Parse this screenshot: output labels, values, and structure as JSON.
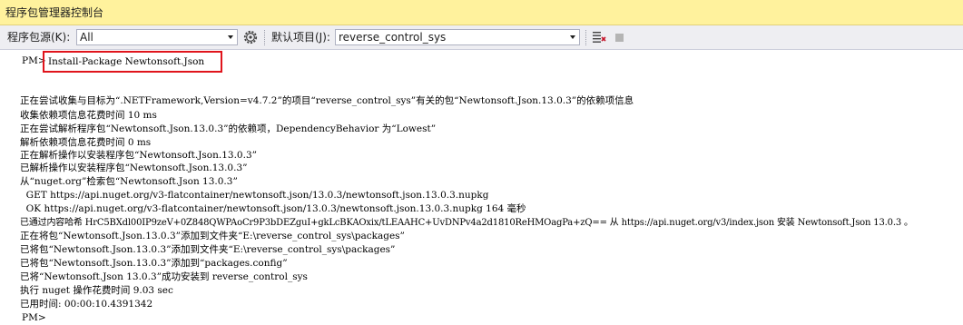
{
  "window": {
    "title": "程序包管理器控制台"
  },
  "toolbar": {
    "source_label": "程序包源(K):",
    "source_value": "All",
    "default_project_label": "默认项目(J):",
    "default_project_value": "reverse_control_sys",
    "settings_icon": "gear-icon",
    "clear_icon": "clear-console-icon",
    "stop_icon": "stop-icon"
  },
  "console": {
    "prompt": "PM>",
    "command": "Install-Package Newtonsoft.Json",
    "output": [
      "正在尝试收集与目标为“.NETFramework,Version=v4.7.2”的项目“reverse_control_sys”有关的包“Newtonsoft.Json.13.0.3”的依赖项信息",
      "收集依赖项信息花费时间 10 ms",
      "正在尝试解析程序包“Newtonsoft.Json.13.0.3”的依赖项，DependencyBehavior 为“Lowest”",
      "解析依赖项信息花费时间 0 ms",
      "正在解析操作以安装程序包“Newtonsoft.Json.13.0.3”",
      "已解析操作以安装程序包“Newtonsoft.Json.13.0.3”",
      "从“nuget.org”检索包“Newtonsoft.Json 13.0.3”",
      "  GET https://api.nuget.org/v3-flatcontainer/newtonsoft.json/13.0.3/newtonsoft.json.13.0.3.nupkg",
      "  OK https://api.nuget.org/v3-flatcontainer/newtonsoft.json/13.0.3/newtonsoft.json.13.0.3.nupkg 164 毫秒",
      "已通过内容哈希 HrC5BXdl00IP9zeV+0Z848QWPAoCr9P3bDEZguI+gkLcBKAOxix/tLEAAHC+UvDNPv4a2d1810ReHMOagPa+zQ== 从 https://api.nuget.org/v3/index.json 安装 Newtonsoft.Json 13.0.3 。",
      "正在将包“Newtonsoft.Json.13.0.3”添加到文件夹“E:\\reverse_control_sys\\packages”",
      "已将包“Newtonsoft.Json.13.0.3”添加到文件夹“E:\\reverse_control_sys\\packages”",
      "已将包“Newtonsoft.Json.13.0.3”添加到“packages.config”",
      "已将“Newtonsoft.Json 13.0.3”成功安装到 reverse_control_sys",
      "执行 nuget 操作花费时间 9.03 sec",
      "已用时间: 00:00:10.4391342"
    ],
    "final_prompt": "PM>"
  },
  "colors": {
    "title_bar_bg": "#fff29d",
    "toolbar_bg": "#eeeef2",
    "highlight_border": "#e0141c"
  }
}
